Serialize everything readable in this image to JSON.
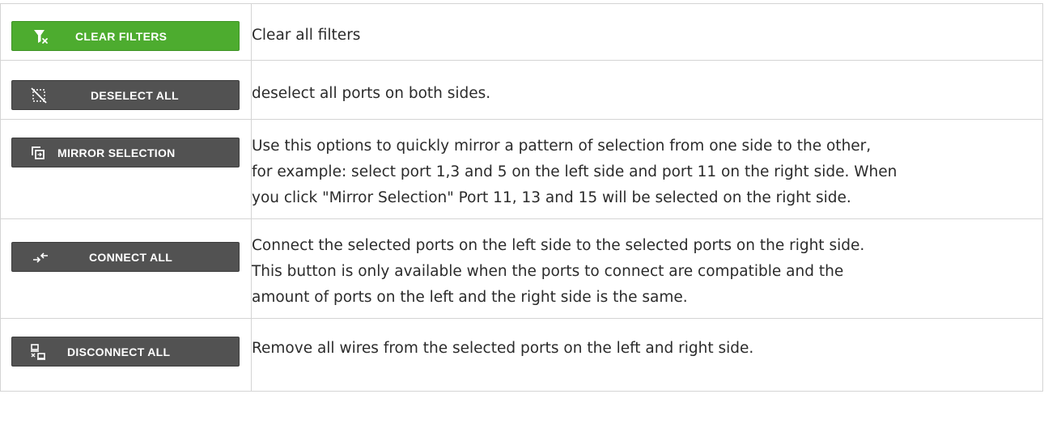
{
  "rows": [
    {
      "button_label": "CLEAR FILTERS",
      "icon": "filter-clear-icon",
      "color": "#4dac2f",
      "description": "Clear all filters"
    },
    {
      "button_label": "DESELECT ALL",
      "icon": "deselect-icon",
      "color": "#525252",
      "description": "deselect all ports on both sides."
    },
    {
      "button_label": "MIRROR SELECTION",
      "icon": "mirror-icon",
      "color": "#525252",
      "description_lines": [
        "Use this options to quickly mirror a pattern of selection from one side to the other,",
        "for example: select port 1,3 and 5 on the left side and port 11 on the right side. When",
        "you click \"Mirror Selection\" Port 11, 13 and 15 will be selected on the right side."
      ]
    },
    {
      "button_label": "CONNECT ALL",
      "icon": "connect-icon",
      "color": "#525252",
      "description_lines": [
        "Connect the selected ports on the left side to the selected ports on the right side.",
        "This button is only available when the ports to connect are compatible and the",
        "amount of ports on the left and the right side is the same."
      ]
    },
    {
      "button_label": "DISCONNECT ALL",
      "icon": "disconnect-icon",
      "color": "#525252",
      "description": "Remove all wires from the selected ports on the left and right side."
    }
  ]
}
